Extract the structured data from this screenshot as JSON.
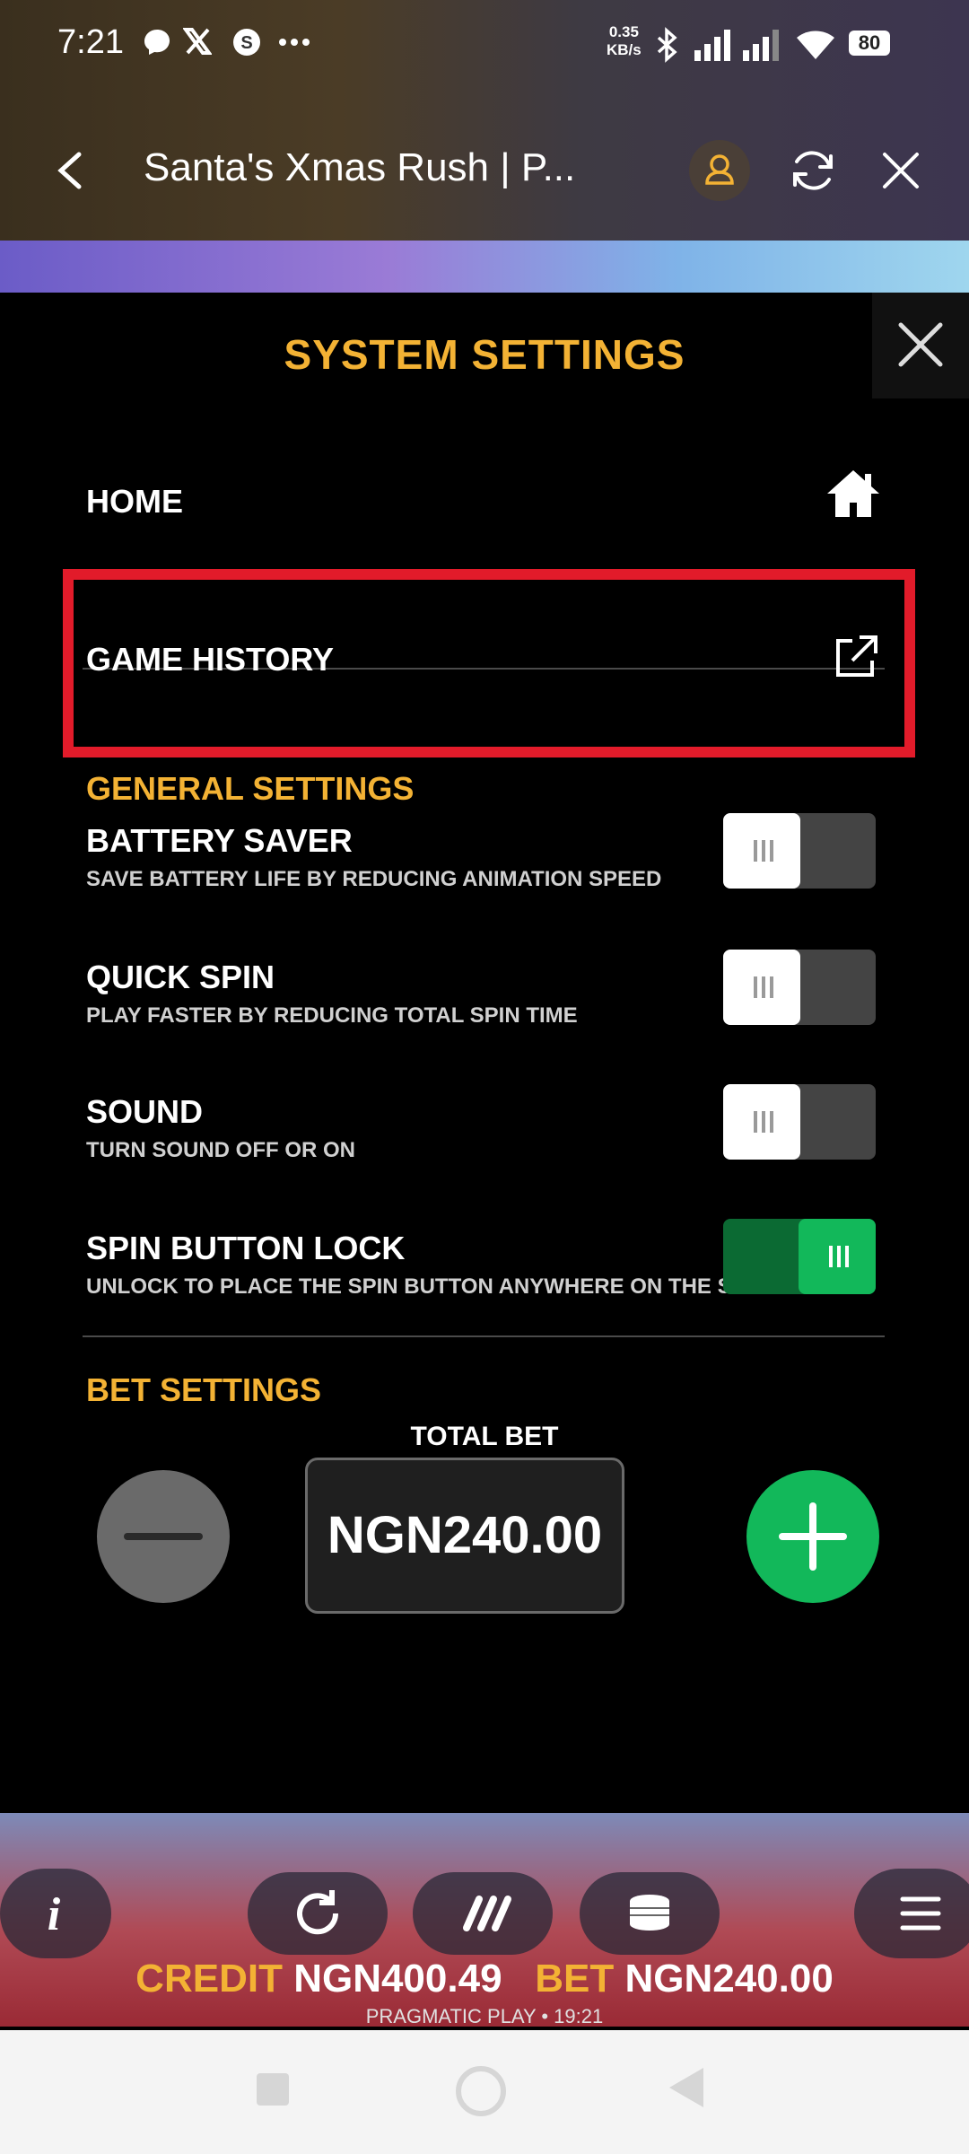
{
  "status_bar": {
    "time": "7:21",
    "net_speed_value": "0.35",
    "net_speed_unit": "KB/s",
    "battery": "80",
    "icons": [
      "messenger-icon",
      "x-icon",
      "s-app-icon",
      "more-dots-icon",
      "bluetooth-icon",
      "signal-icon",
      "signal-icon-2",
      "wifi-icon",
      "battery-icon"
    ]
  },
  "browser": {
    "title": "Santa's Xmas Rush | P...",
    "icons": [
      "back-icon",
      "user-icon",
      "refresh-icon",
      "close-icon"
    ]
  },
  "settings": {
    "title": "SYSTEM SETTINGS",
    "home_label": "HOME",
    "game_history_label": "GAME HISTORY",
    "general_settings_label": "GENERAL SETTINGS",
    "battery_saver": {
      "label": "BATTERY SAVER",
      "desc": "SAVE BATTERY LIFE BY REDUCING ANIMATION SPEED",
      "on": false
    },
    "quick_spin": {
      "label": "QUICK SPIN",
      "desc": "PLAY FASTER BY REDUCING TOTAL SPIN TIME",
      "on": false
    },
    "sound": {
      "label": "SOUND",
      "desc": "TURN SOUND OFF OR ON",
      "on": false
    },
    "spin_button_lock": {
      "label": "SPIN BUTTON LOCK",
      "desc": "UNLOCK TO PLACE THE SPIN BUTTON ANYWHERE ON THE SCREEN",
      "on": true
    },
    "bet_settings_label": "BET SETTINGS",
    "total_bet_label": "TOTAL BET",
    "total_bet_value": "NGN240.00"
  },
  "game_bar": {
    "credit_label": "CREDIT",
    "credit_value": "NGN400.49",
    "bet_label": "BET",
    "bet_value": "NGN240.00",
    "provider": "PRAGMATIC PLAY • 19:21"
  },
  "colors": {
    "accent_gold": "#f3b234",
    "toggle_on": "#12b85a",
    "highlight_red": "#e21b2a"
  }
}
